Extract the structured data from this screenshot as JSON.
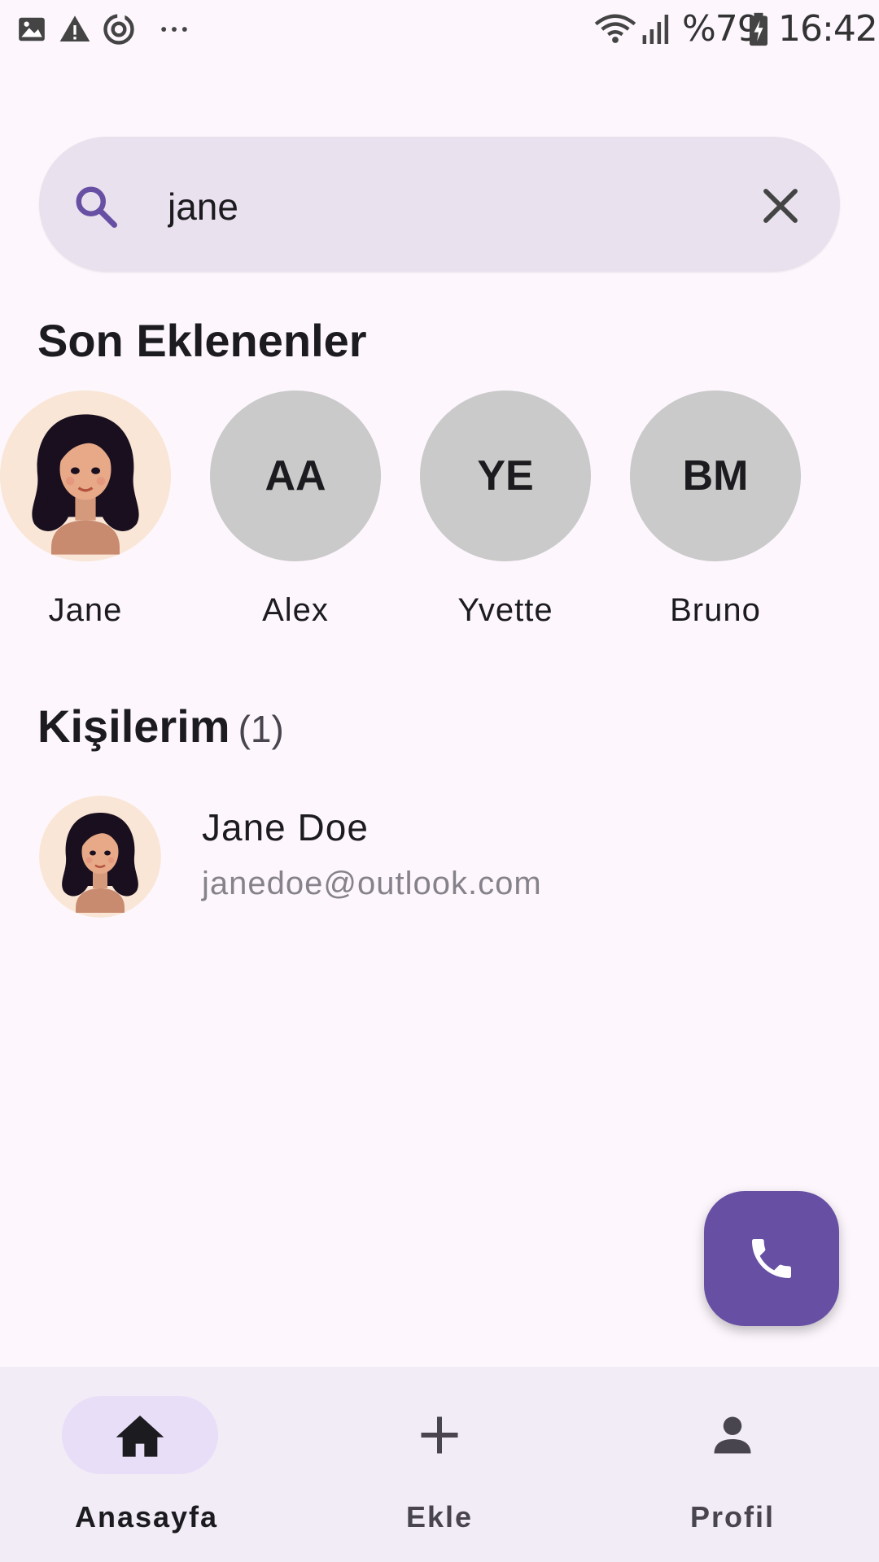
{
  "status_bar": {
    "battery": "%79",
    "time": "16:42",
    "icons": [
      "image-icon",
      "warning-icon",
      "sync-icon",
      "more-dots-icon",
      "wifi-icon",
      "signal-icon",
      "battery-icon"
    ]
  },
  "search": {
    "query": "jane",
    "placeholder": "",
    "search_icon": "search-icon",
    "clear_icon": "close-icon"
  },
  "recent": {
    "title": "Son Eklenenler",
    "items": [
      {
        "name": "Jane",
        "initials": "",
        "has_photo": true
      },
      {
        "name": "Alex",
        "initials": "AA",
        "has_photo": false
      },
      {
        "name": "Yvette",
        "initials": "YE",
        "has_photo": false
      },
      {
        "name": "Bruno",
        "initials": "BM",
        "has_photo": false
      }
    ]
  },
  "contacts": {
    "title": "Kişilerim",
    "count": "(1)",
    "items": [
      {
        "name": "Jane Doe",
        "email": "janedoe@outlook.com"
      }
    ]
  },
  "fab": {
    "icon": "phone-icon"
  },
  "nav": {
    "items": [
      {
        "label": "Anasayfa",
        "icon": "home-icon",
        "active": true
      },
      {
        "label": "Ekle",
        "icon": "plus-icon",
        "active": false
      },
      {
        "label": "Profil",
        "icon": "person-icon",
        "active": false
      }
    ]
  },
  "colors": {
    "background": "#FDF7FD",
    "search_bg": "#E9E2EE",
    "accent": "#6750A4",
    "nav_bg": "#F2ECF6",
    "nav_indicator": "#E8DEF8",
    "avatar_placeholder": "#CACACA",
    "avatar_photo_bg": "#F9E6D6"
  }
}
